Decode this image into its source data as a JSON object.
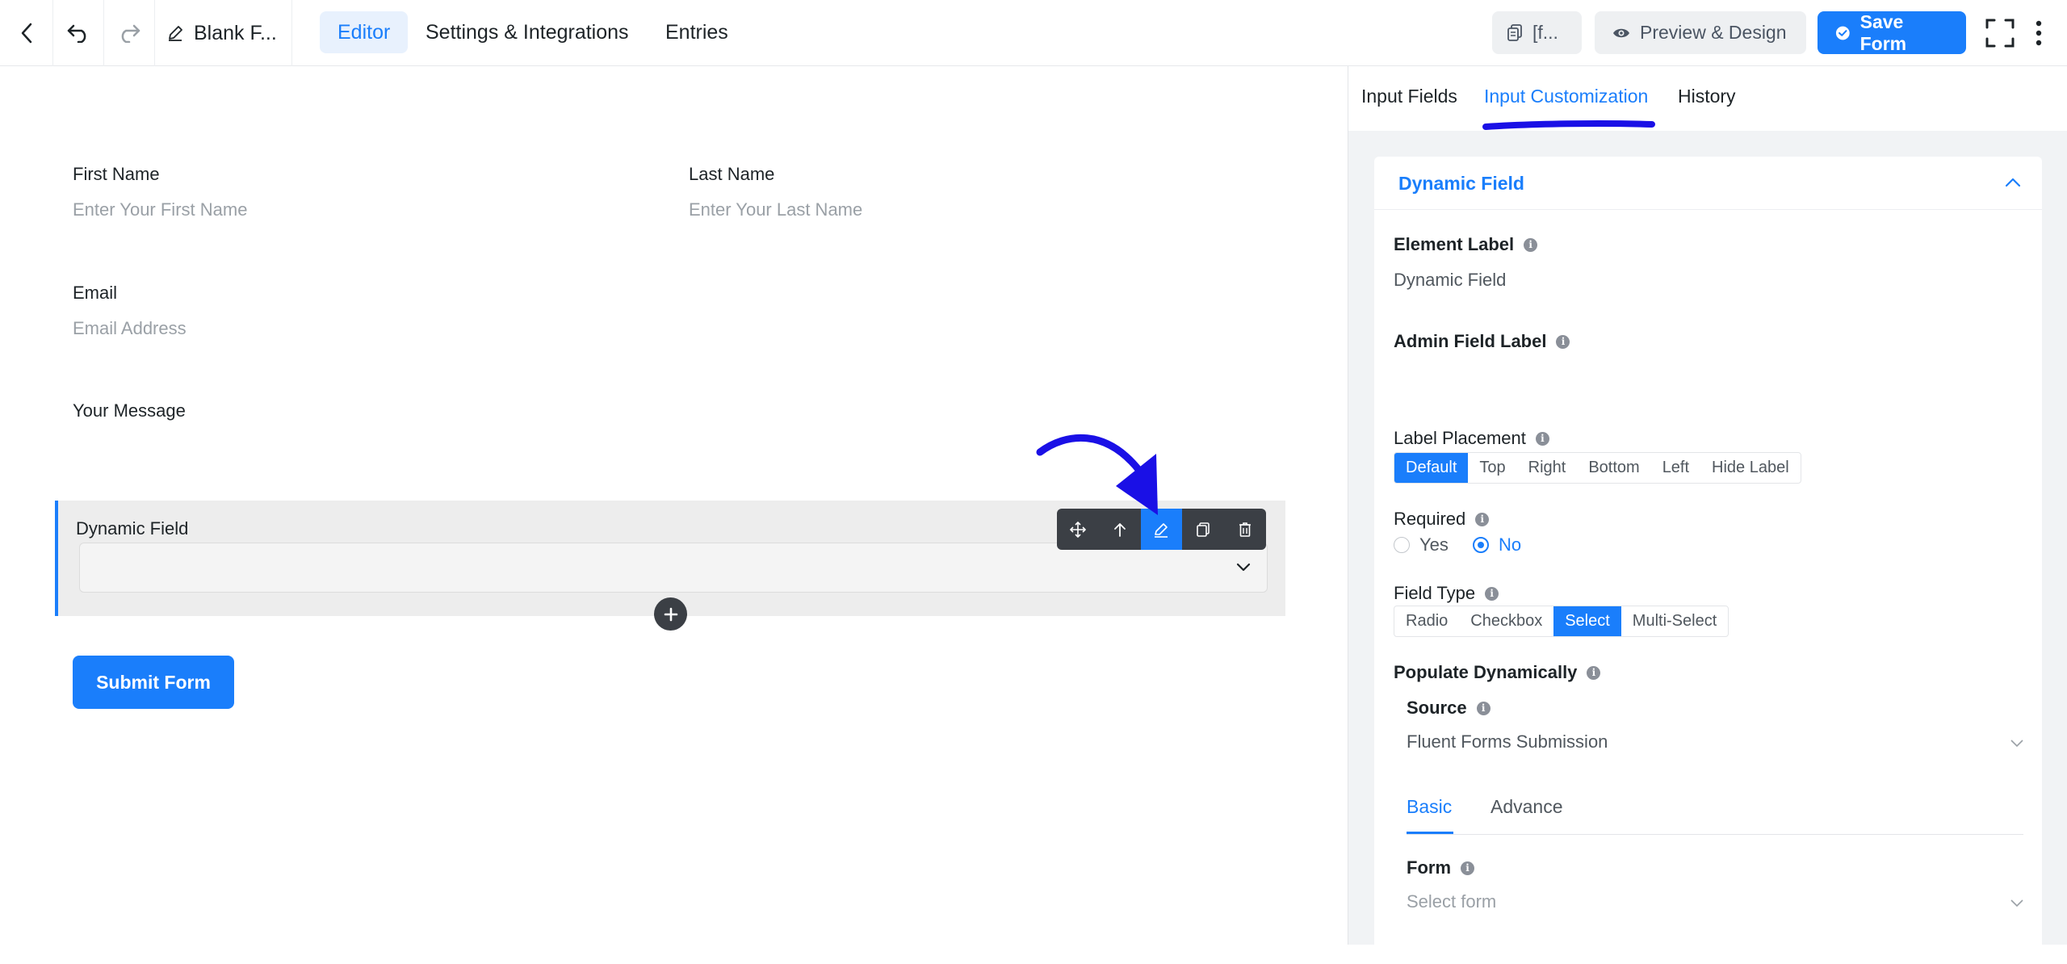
{
  "topbar": {
    "title": "Blank F...",
    "tabs": [
      {
        "label": "Editor",
        "active": true
      },
      {
        "label": "Settings & Integrations",
        "active": false
      },
      {
        "label": "Entries",
        "active": false
      }
    ],
    "shortcode_label": "[f...",
    "preview_label": "Preview & Design",
    "save_label": "Save Form"
  },
  "form": {
    "first_name": {
      "label": "First Name",
      "placeholder": "Enter Your First Name"
    },
    "last_name": {
      "label": "Last Name",
      "placeholder": "Enter Your Last Name"
    },
    "email": {
      "label": "Email",
      "placeholder": "Email Address"
    },
    "message": {
      "label": "Your Message"
    },
    "dynamic": {
      "label": "Dynamic Field"
    },
    "submit_label": "Submit Form"
  },
  "panel": {
    "tabs": [
      {
        "label": "Input Fields",
        "active": false
      },
      {
        "label": "Input Customization",
        "active": true
      },
      {
        "label": "History",
        "active": false
      }
    ],
    "section_title": "Dynamic Field",
    "element_label": {
      "label": "Element Label",
      "value": "Dynamic Field"
    },
    "admin_field_label": {
      "label": "Admin Field Label",
      "value": ""
    },
    "label_placement": {
      "label": "Label Placement",
      "options": [
        "Default",
        "Top",
        "Right",
        "Bottom",
        "Left",
        "Hide Label"
      ],
      "selected": "Default"
    },
    "required": {
      "label": "Required",
      "options": [
        "Yes",
        "No"
      ],
      "selected": "No"
    },
    "field_type": {
      "label": "Field Type",
      "options": [
        "Radio",
        "Checkbox",
        "Select",
        "Multi-Select"
      ],
      "selected": "Select"
    },
    "populate": {
      "label": "Populate Dynamically"
    },
    "source": {
      "label": "Source",
      "value": "Fluent Forms Submission"
    },
    "sub_tabs": [
      {
        "label": "Basic",
        "active": true
      },
      {
        "label": "Advance",
        "active": false
      }
    ],
    "form_select": {
      "label": "Form",
      "placeholder": "Select form"
    }
  },
  "colors": {
    "accent": "#1a7efb",
    "annotation": "#1a10e6",
    "toolbar": "#3b3f45"
  }
}
